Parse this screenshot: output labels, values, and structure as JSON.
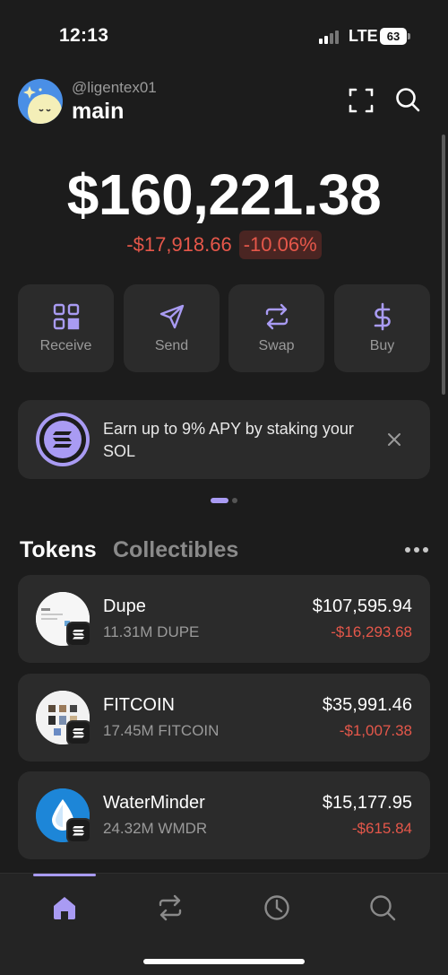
{
  "status_bar": {
    "time": "12:13",
    "network": "LTE",
    "battery": "63"
  },
  "header": {
    "handle": "@ligentex01",
    "wallet_name": "main"
  },
  "balance": {
    "total": "$160,221.38",
    "change_amount": "-$17,918.66",
    "change_percent": "-10.06%"
  },
  "actions": [
    {
      "label": "Receive",
      "icon": "qr-code-icon"
    },
    {
      "label": "Send",
      "icon": "send-icon"
    },
    {
      "label": "Swap",
      "icon": "swap-icon"
    },
    {
      "label": "Buy",
      "icon": "dollar-icon"
    }
  ],
  "promo": {
    "text": "Earn up to 9% APY by staking your SOL",
    "icon": "solana-icon"
  },
  "tabs": {
    "tokens": "Tokens",
    "collectibles": "Collectibles"
  },
  "tokens": [
    {
      "name": "Dupe",
      "amount": "11.31M DUPE",
      "value": "$107,595.94",
      "change": "-$16,293.68"
    },
    {
      "name": "FITCOIN",
      "amount": "17.45M FITCOIN",
      "value": "$35,991.46",
      "change": "-$1,007.38"
    },
    {
      "name": "WaterMinder",
      "amount": "24.32M WMDR",
      "value": "$15,177.95",
      "change": "-$615.84"
    }
  ],
  "bottom_nav": [
    {
      "name": "home-icon",
      "active": true
    },
    {
      "name": "swap-icon",
      "active": false
    },
    {
      "name": "history-icon",
      "active": false
    },
    {
      "name": "search-icon",
      "active": false
    }
  ],
  "colors": {
    "background": "#1c1c1c",
    "card": "#2b2b2b",
    "accent": "#a99bf3",
    "negative": "#e5574a",
    "muted": "#9a9a9a"
  }
}
